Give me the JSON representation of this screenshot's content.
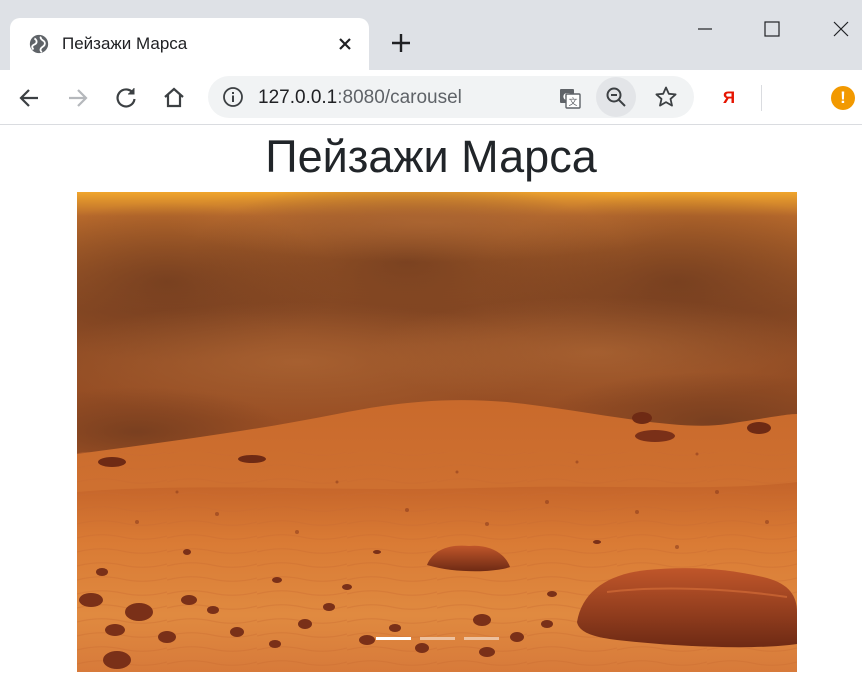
{
  "browser": {
    "tab": {
      "title": "Пейзажи Марса",
      "favicon": "globe-icon"
    },
    "address": {
      "host": "127.0.0.1",
      "rest": ":8080/carousel"
    },
    "extensions": {
      "yandex_label": "Я",
      "alert_label": "!"
    }
  },
  "page": {
    "heading": "Пейзажи Марса"
  },
  "carousel": {
    "slide_count": 3,
    "active_index": 0,
    "slide_alt": "Mars landscape"
  },
  "colors": {
    "tabstrip": "#dee1e6",
    "omnibox": "#f1f3f4",
    "heading": "#212529",
    "alert": "#f29900",
    "yandex": "#e61400"
  }
}
